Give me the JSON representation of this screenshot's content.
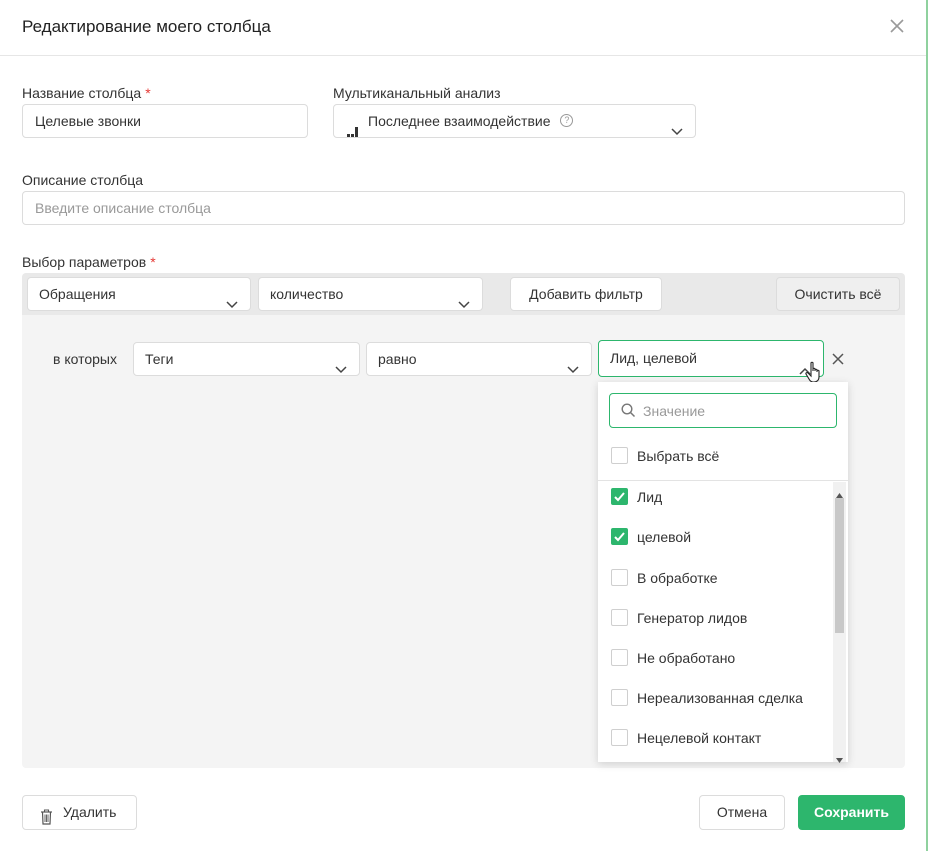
{
  "dialog": {
    "title": "Редактирование моего столбца"
  },
  "column_name": {
    "label": "Название столбца",
    "required_mark": "*",
    "value": "Целевые звонки"
  },
  "multichannel": {
    "label": "Мультиканальный анализ",
    "value": "Последнее взаимодействие"
  },
  "description": {
    "label": "Описание столбца",
    "placeholder": "Введите описание столбца"
  },
  "params": {
    "label": "Выбор параметров",
    "required_mark": "*",
    "entity_select": "Обращения",
    "metric_select": "количество",
    "add_filter": "Добавить фильтр",
    "clear_all": "Очистить всё"
  },
  "filter": {
    "prefix": "в которых",
    "field": "Теги",
    "operator": "равно",
    "value": "Лид, целевой"
  },
  "value_dropdown": {
    "search_placeholder": "Значение",
    "select_all": "Выбрать всё",
    "options": [
      {
        "label": "Лид",
        "checked": true
      },
      {
        "label": "целевой",
        "checked": true
      },
      {
        "label": "В обработке",
        "checked": false
      },
      {
        "label": "Генератор лидов",
        "checked": false
      },
      {
        "label": "Не обработано",
        "checked": false
      },
      {
        "label": "Нереализованная сделка",
        "checked": false
      },
      {
        "label": "Нецелевой контакт",
        "checked": false
      }
    ]
  },
  "footer": {
    "delete": "Удалить",
    "cancel": "Отмена",
    "save": "Сохранить"
  },
  "colors": {
    "accent": "#2db66d",
    "required": "#e53935"
  }
}
